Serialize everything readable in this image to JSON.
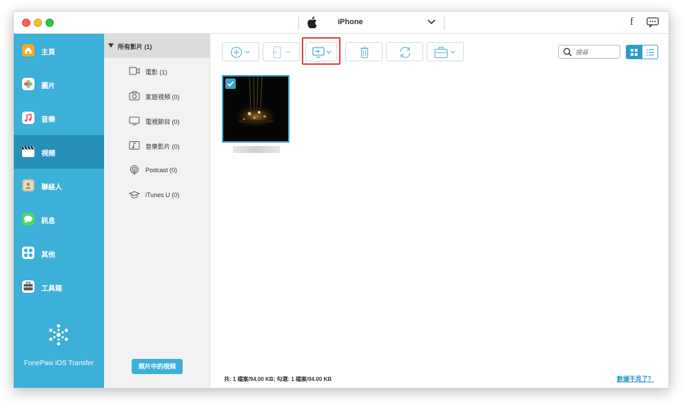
{
  "titlebar": {
    "device_name": "iPhone",
    "social_icon": "f"
  },
  "sidebar": {
    "items": [
      {
        "label": "主頁",
        "icon": "home-icon",
        "color": "#f7a823"
      },
      {
        "label": "圖片",
        "icon": "photos-icon",
        "color": "#ffffff"
      },
      {
        "label": "音樂",
        "icon": "music-icon",
        "color": "#fc4a6e"
      },
      {
        "label": "視頻",
        "icon": "video-icon",
        "color": "#ffffff",
        "active": true
      },
      {
        "label": "聯絡人",
        "icon": "contacts-icon",
        "color": "#c9b99a"
      },
      {
        "label": "訊息",
        "icon": "messages-icon",
        "color": "#4cd964"
      },
      {
        "label": "其他",
        "icon": "other-icon",
        "color": "#ffffff"
      },
      {
        "label": "工具箱",
        "icon": "toolbox-icon",
        "color": "#ffffff"
      }
    ],
    "brand_name": "FonePaw iOS Transfer"
  },
  "categories": {
    "header": "所有影片 (1)",
    "items": [
      {
        "label": "電影 (1)",
        "icon": "movie-icon"
      },
      {
        "label": "家庭視頻 (0)",
        "icon": "home-video-icon"
      },
      {
        "label": "電視節目 (0)",
        "icon": "tv-icon"
      },
      {
        "label": "音樂影片 (0)",
        "icon": "music-video-icon"
      },
      {
        "label": "Podcast (0)",
        "icon": "podcast-icon"
      },
      {
        "label": "iTunes U (0)",
        "icon": "itunes-u-icon"
      }
    ],
    "photo_video_button": "照片中的視頻"
  },
  "toolbar": {
    "search_placeholder": "搜尋",
    "buttons": [
      "add-icon",
      "export-device-icon",
      "export-pc-icon",
      "delete-icon",
      "convert-icon",
      "toolbox-icon"
    ]
  },
  "main": {
    "status": "共: 1 檔案/94.00 KB; 勾選: 1 檔案/94.00 KB",
    "data_lost_link": "數據不見了？"
  },
  "colors": {
    "sidebar": "#3cb0d9",
    "sidebar_active": "#2591b8",
    "accent": "#2b9cc4",
    "highlight": "#e23b3b"
  }
}
